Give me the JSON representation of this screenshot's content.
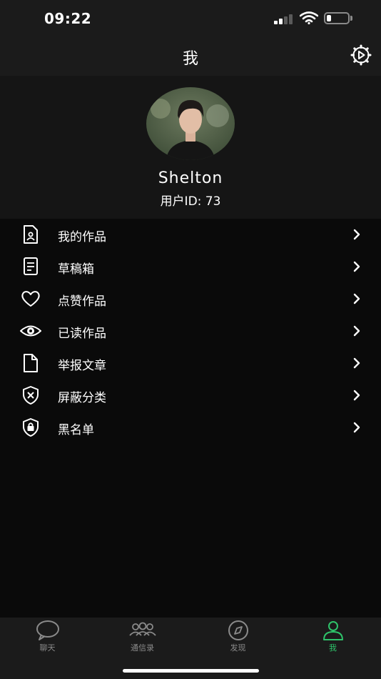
{
  "status_bar": {
    "time": "09:22",
    "battery_level": 0.2
  },
  "nav": {
    "title": "我"
  },
  "profile": {
    "username": "Shelton",
    "user_id_label": "用户ID: 73"
  },
  "menu": [
    {
      "label": "我的作品",
      "icon": "document-user-icon"
    },
    {
      "label": "草稿箱",
      "icon": "draft-list-icon"
    },
    {
      "label": "点赞作品",
      "icon": "heart-icon"
    },
    {
      "label": "已读作品",
      "icon": "eye-icon"
    },
    {
      "label": "举报文章",
      "icon": "file-icon"
    },
    {
      "label": "屏蔽分类",
      "icon": "shield-x-icon"
    },
    {
      "label": "黑名单",
      "icon": "shield-lock-icon"
    }
  ],
  "tabs": [
    {
      "label": "聊天",
      "icon": "chat-bubble-icon",
      "active": false
    },
    {
      "label": "通信录",
      "icon": "contacts-icon",
      "active": false
    },
    {
      "label": "发现",
      "icon": "compass-icon",
      "active": false
    },
    {
      "label": "我",
      "icon": "person-icon",
      "active": true
    }
  ],
  "colors": {
    "accent": "#2ec36a",
    "background": "#0a0a0a",
    "bar": "#1b1b1b",
    "inactive": "#8a8a8a"
  }
}
